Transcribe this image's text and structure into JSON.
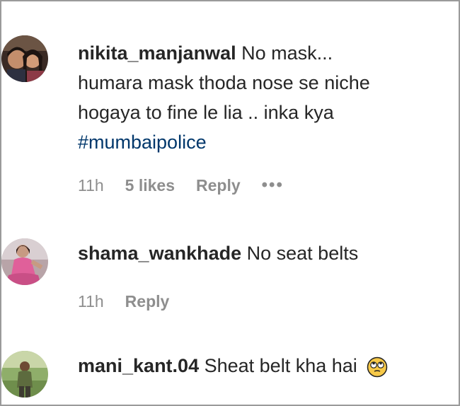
{
  "comments": [
    {
      "username": "nikita_manjanwal",
      "text_line1": "No mask...",
      "text_line2": "humara mask thoda nose se niche",
      "text_line3": "hogaya to fine le lia .. inka kya",
      "hashtag": "#mumbaipolice",
      "time": "11h",
      "likes": "5 likes",
      "reply": "Reply",
      "more": "•••",
      "avatar_icon": "couple-photo-avatar"
    },
    {
      "username": "shama_wankhade",
      "text": "No seat belts",
      "time": "11h",
      "reply": "Reply",
      "avatar_icon": "woman-pink-dress-avatar"
    },
    {
      "username": "mani_kant.04",
      "text": "Sheat belt kha hai",
      "emoji": "face-with-rolling-eyes-emoji",
      "avatar_icon": "man-outdoor-avatar"
    }
  ],
  "colors": {
    "text": "#262626",
    "meta": "#8e8e8e",
    "hashtag": "#00376b",
    "border": "#9a9a9a"
  }
}
